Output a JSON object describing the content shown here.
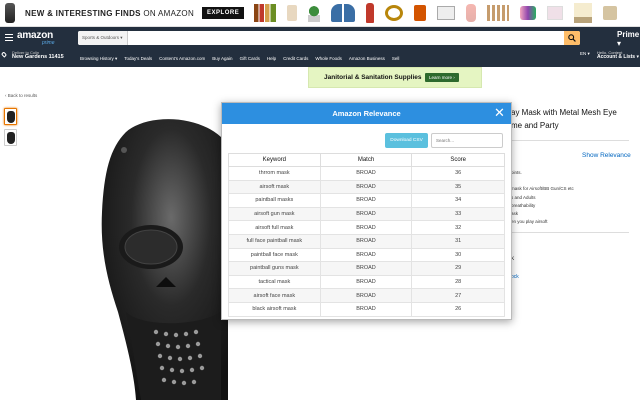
{
  "banner": {
    "promo_bold": "NEW & INTERESTING FINDS",
    "promo_rest": " ON AMAZON",
    "explore": "EXPLORE"
  },
  "nav": {
    "logo": "amazon",
    "logo_prime": "prime",
    "search_department": "Sports & Outdoors ▾",
    "prime": "Prime ▾",
    "deliver_top": "Deliver to Colin",
    "deliver_bottom": "New Gardens 11415",
    "links": [
      "Browsing History ▾",
      "Today's Deals",
      "Content's Amazon.com",
      "Buy Again",
      "Gift Cards",
      "Help",
      "Credit Cards",
      "Whole Foods",
      "Amazon Business",
      "Sell"
    ],
    "lang": "EN ▾",
    "account_top": "Hello, Content",
    "account_bottom": "Account & Lists ▾"
  },
  "ad": {
    "text": "Janitorial & Sanitation Supplies",
    "button": "Learn more ›"
  },
  "back": "‹ Back to results",
  "product": {
    "title_line1": "ay Mask with Metal Mesh Eye",
    "title_line2": "me and Party",
    "show_relevance": "Show Relevance",
    "bullets": [
      "oints.",
      "mask for Airsoft/BB Gun/CS etc",
      "s and Adults",
      "breathability",
      "ask",
      "en you play airsoft"
    ],
    "frag1": "k",
    "frag2": "ock"
  },
  "modal": {
    "title": "Amazon Relevance",
    "close": "✕",
    "download": "Download CSV",
    "search_placeholder": "Search...",
    "columns": [
      "Keyword",
      "Match",
      "Score"
    ],
    "rows": [
      [
        "thrrom mask",
        "BROAD",
        "36"
      ],
      [
        "airsoft mask",
        "BROAD",
        "35"
      ],
      [
        "paintball masks",
        "BROAD",
        "34"
      ],
      [
        "airsoft gun mask",
        "BROAD",
        "33"
      ],
      [
        "airsoft full mask",
        "BROAD",
        "32"
      ],
      [
        "full face paintball mask",
        "BROAD",
        "31"
      ],
      [
        "paintball face mask",
        "BROAD",
        "30"
      ],
      [
        "paintball guns mask",
        "BROAD",
        "29"
      ],
      [
        "tactical mask",
        "BROAD",
        "28"
      ],
      [
        "airsoft face mask",
        "BROAD",
        "27"
      ],
      [
        "black airsoft mask",
        "BROAD",
        "26"
      ]
    ]
  }
}
